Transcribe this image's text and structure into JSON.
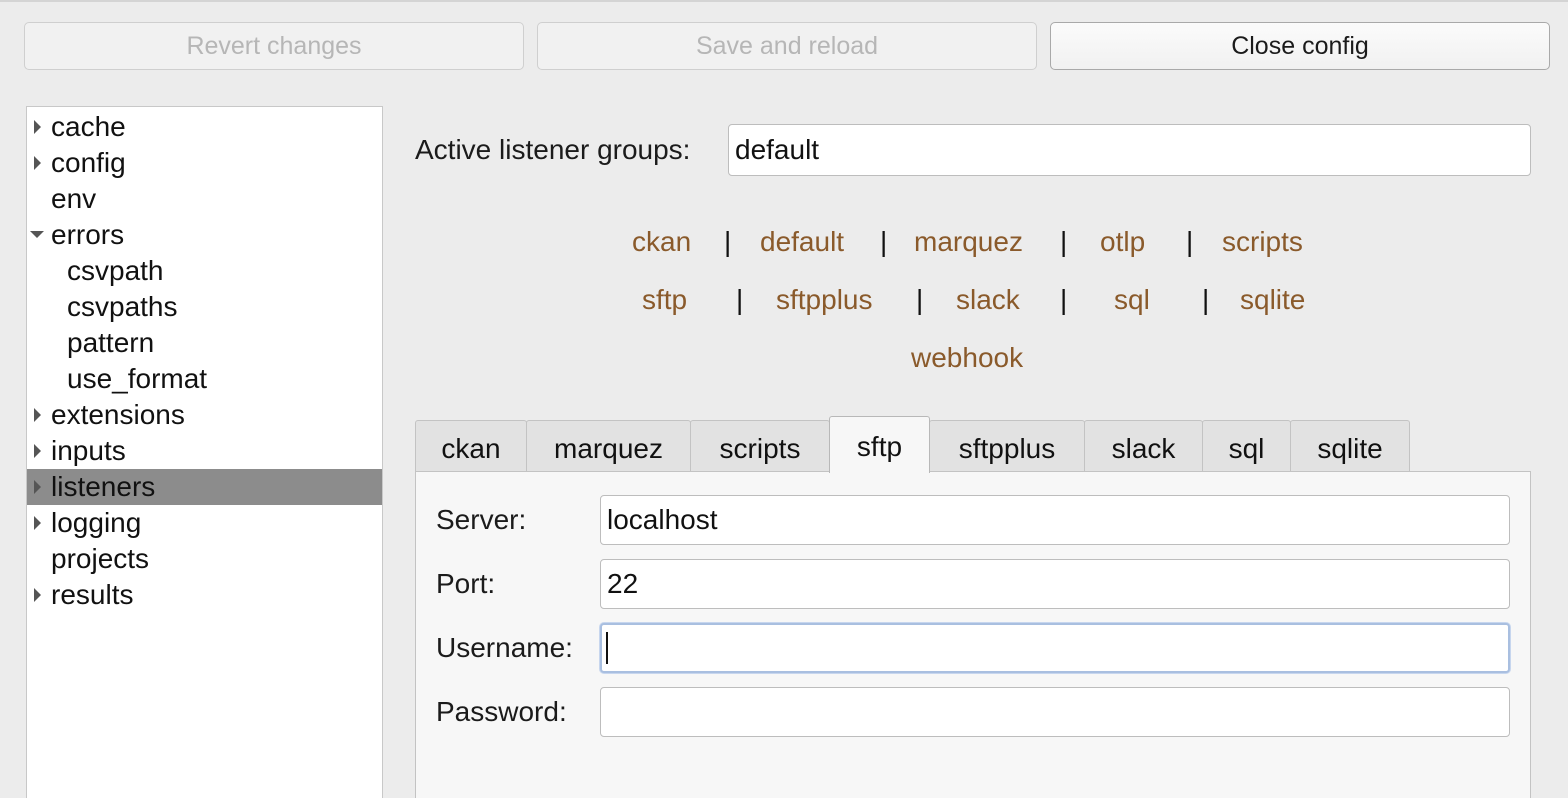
{
  "toolbar": {
    "revert_label": "Revert changes",
    "save_label": "Save and reload",
    "close_label": "Close config"
  },
  "tree": {
    "items": [
      {
        "label": "cache",
        "expander": "collapsed"
      },
      {
        "label": "config",
        "expander": "collapsed"
      },
      {
        "label": "env",
        "expander": "none"
      },
      {
        "label": "errors",
        "expander": "expanded"
      },
      {
        "label": "csvpath",
        "expander": "child"
      },
      {
        "label": "csvpaths",
        "expander": "child"
      },
      {
        "label": "pattern",
        "expander": "child"
      },
      {
        "label": "use_format",
        "expander": "child"
      },
      {
        "label": "extensions",
        "expander": "collapsed"
      },
      {
        "label": "inputs",
        "expander": "collapsed"
      },
      {
        "label": "listeners",
        "expander": "collapsed",
        "selected": true
      },
      {
        "label": "logging",
        "expander": "collapsed"
      },
      {
        "label": "projects",
        "expander": "none"
      },
      {
        "label": "results",
        "expander": "collapsed"
      }
    ]
  },
  "active_groups": {
    "label": "Active listener groups:",
    "value": "default"
  },
  "group_links": {
    "row1": [
      "ckan",
      "default",
      "marquez",
      "otlp",
      "scripts"
    ],
    "row2": [
      "sftp",
      "sftpplus",
      "slack",
      "sql",
      "sqlite"
    ],
    "row3": [
      "webhook"
    ],
    "separator": "|",
    "link_color": "#8a5a2b"
  },
  "tabs": {
    "items": [
      "ckan",
      "marquez",
      "scripts",
      "sftp",
      "sftpplus",
      "slack",
      "sql",
      "sqlite"
    ],
    "active": "sftp"
  },
  "form": {
    "server_label": "Server:",
    "server_value": "localhost",
    "port_label": "Port:",
    "port_value": "22",
    "username_label": "Username:",
    "username_value": "",
    "password_label": "Password:",
    "password_value": ""
  }
}
